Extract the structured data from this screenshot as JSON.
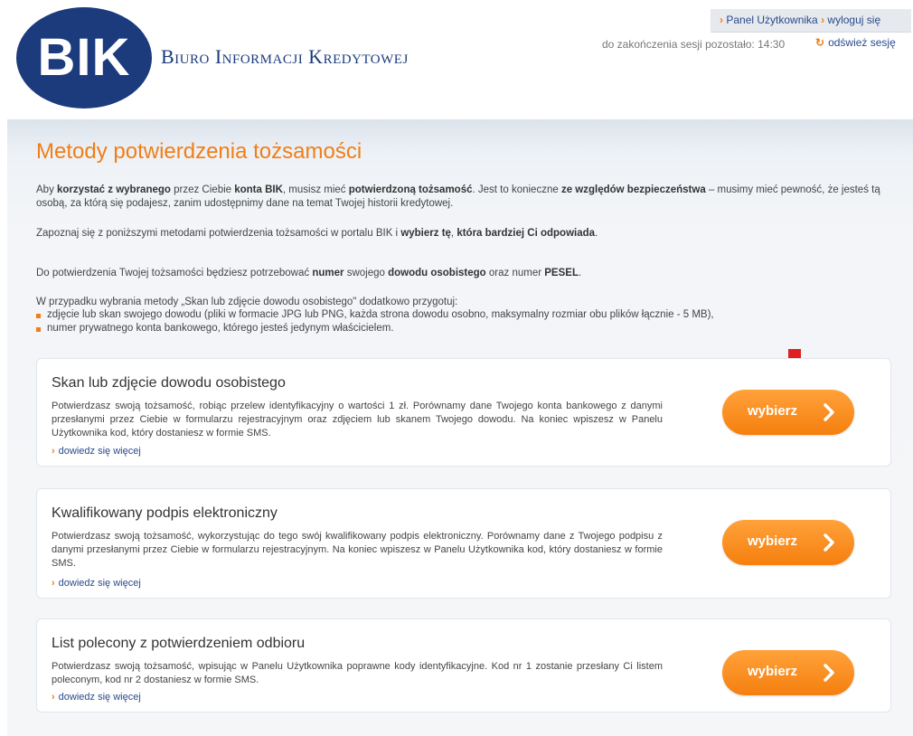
{
  "header": {
    "logo_text": "BIK",
    "brand_name": "Biuro Informacji Kredytowej",
    "panel_link": "Panel Użytkownika",
    "logout_link": "wyloguj się",
    "session_text": "do zakończenia sesji pozostało: 14:30",
    "refresh_link": "odśwież sesję"
  },
  "main": {
    "title": "Metody potwierdzenia tożsamości",
    "intro": {
      "t1": "Aby ",
      "b1": "korzystać z wybranego",
      "t2": " przez Ciebie ",
      "b2": "konta BIK",
      "t3": ", musisz mieć ",
      "b3": "potwierdzoną tożsamość",
      "t4": ". Jest to konieczne ",
      "b4": "ze względów bezpieczeństwa",
      "t5": " – musimy mieć pewność, że jesteś tą osobą, za którą się podajesz, zanim udostępnimy dane na temat Twojej historii kredytowej."
    },
    "choose": {
      "t1": "Zapoznaj się z poniższymi metodami potwierdzenia tożsamości w portalu BIK i ",
      "b1": "wybierz tę",
      "t2": ", ",
      "b2": "która bardziej Ci odpowiada",
      "t3": "."
    },
    "needs": {
      "t1": "Do potwierdzenia Twojej tożsamości będziesz potrzebować ",
      "b1": "numer",
      "t2": " swojego ",
      "b2": "dowodu osobistego",
      "t3": " oraz numer ",
      "b3": "PESEL",
      "t4": "."
    },
    "scan_prep": "W przypadku wybrania metody „Skan lub zdjęcie dowodu osobistego\" dodatkowo przygotuj:",
    "bullets": [
      "zdjęcie lub skan swojego dowodu (pliki w formacie JPG lub PNG, każda strona dowodu osobno, maksymalny rozmiar obu plików łącznie - 5 MB),",
      "numer prywatnego konta bankowego, którego jesteś jedynym właścicielem."
    ]
  },
  "methods": [
    {
      "title": "Skan lub zdjęcie dowodu osobistego",
      "description": "Potwierdzasz swoją tożsamość, robiąc przelew identyfikacyjny o wartości 1 zł. Porównamy dane Twojego konta bankowego z danymi przesłanymi przez Ciebie w formularzu rejestracyjnym oraz zdjęciem lub skanem Twojego dowodu. Na koniec wpiszesz w Panelu Użytkownika kod, który dostaniesz w formie SMS.",
      "more": "dowiedz się więcej",
      "button": "wybierz"
    },
    {
      "title": "Kwalifikowany podpis elektroniczny",
      "description": "Potwierdzasz swoją tożsamość, wykorzystując do tego swój kwalifikowany podpis elektroniczny. Porównamy dane z Twojego podpisu z danymi przesłanymi przez Ciebie w formularzu rejestracyjnym. Na koniec wpiszesz w Panelu Użytkownika kod, który dostaniesz w formie SMS.",
      "more": "dowiedz się więcej",
      "button": "wybierz"
    },
    {
      "title": "List polecony z potwierdzeniem odbioru",
      "description": "Potwierdzasz swoją tożsamość, wpisując w Panelu Użytkownika poprawne kody identyfikacyjne. Kod nr 1 zostanie przesłany Ci listem poleconym, kod nr 2 dostaniesz w formie SMS.",
      "more": "dowiedz się więcej",
      "button": "wybierz"
    }
  ],
  "colors": {
    "brand_blue": "#1b3b7d",
    "accent_orange": "#f07e17",
    "indicator_red": "#e02020"
  },
  "icons": {
    "chevron": "chevron-right-icon",
    "refresh": "refresh-icon",
    "indicator": "down-arrow-icon"
  }
}
